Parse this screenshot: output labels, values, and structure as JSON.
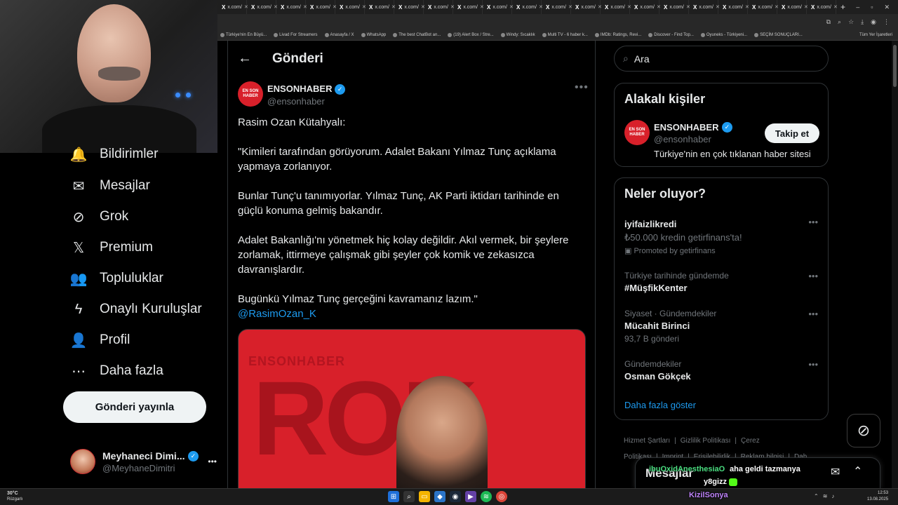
{
  "browser": {
    "tab_label": "x.com/",
    "tab_count": 21,
    "new_tab": "+",
    "window_controls": [
      "–",
      "▫",
      "✕"
    ],
    "bookmarks": [
      "Türkiye'nin En Büyü...",
      "Livad For Streamers",
      "Anasayfa / X",
      "WhatsApp",
      "The best ChatBot an...",
      "(19) Alert Box / Stre...",
      "Windy: Sıcaklık",
      "Multi TV - 6 haber k...",
      "IMDb: Ratings, Revi...",
      "Discover - Find Top...",
      "Oyuneks - Türkiyeni...",
      "SEÇİM SONUÇLARI..."
    ],
    "bookmarks_all": "Tüm Yer İşaretleri"
  },
  "nav": {
    "items": [
      {
        "label": "Bildirimler",
        "icon": "bell-icon",
        "glyph": "🔔"
      },
      {
        "label": "Mesajlar",
        "icon": "mail-icon",
        "glyph": "✉"
      },
      {
        "label": "Grok",
        "icon": "grok-icon",
        "glyph": "⊘"
      },
      {
        "label": "Premium",
        "icon": "x-logo-icon",
        "glyph": "𝕏"
      },
      {
        "label": "Topluluklar",
        "icon": "communities-icon",
        "glyph": "👥"
      },
      {
        "label": "Onaylı Kuruluşlar",
        "icon": "lightning-icon",
        "glyph": "ϟ"
      },
      {
        "label": "Profil",
        "icon": "person-icon",
        "glyph": "👤"
      },
      {
        "label": "Daha fazla",
        "icon": "more-circle-icon",
        "glyph": "⋯"
      }
    ],
    "post_button": "Gönderi yayınla",
    "profile": {
      "name": "Meyhaneci Dimi...",
      "handle": "@MeyhaneDimitri",
      "more": "•••"
    }
  },
  "main": {
    "back": "←",
    "title": "Gönderi",
    "author": {
      "name": "ENSONHABER",
      "handle": "@ensonhaber",
      "avatar_text": "EN SON HABER"
    },
    "more": "•••",
    "paragraphs": [
      "Rasim Ozan Kütahyalı:",
      "\"Kimileri tarafından görüyorum. Adalet Bakanı Yılmaz Tunç açıklama yapmaya zorlanıyor.",
      "Bunlar Tunç'u tanımıyorlar. Yılmaz Tunç, AK Parti iktidarı tarihinde en güçlü konuma gelmiş bakandır.",
      "Adalet Bakanlığı'nı yönetmek hiç kolay değildir. Akıl vermek, bir şeylere zorlamak, ittirmeye çalışmak gibi şeyler çok komik ve zekasızca davranışlardır."
    ],
    "last_paragraph": "Bugünkü Yılmaz Tunç gerçeğini kavramanız lazım.\"",
    "mention": "@RasimOzan_K",
    "media": {
      "brand": "ENSONHABER",
      "bigtext": "ROK"
    }
  },
  "right": {
    "search_placeholder": "Ara",
    "related": {
      "title": "Alakalı kişiler",
      "name": "ENSONHABER",
      "handle": "@ensonhaber",
      "bio": "Türkiye'nin en çok tıklanan haber sitesi",
      "follow": "Takip et"
    },
    "trends": {
      "title": "Neler oluyor?",
      "items": [
        {
          "meta": "",
          "name": "iyifaizlikredi",
          "sub": "₺50.000 kredin getirfinans'ta!",
          "promo": "Promoted by getirfinans"
        },
        {
          "meta": "Türkiye tarihinde gündemde",
          "name": "#MüşfikKenter",
          "sub": "",
          "promo": ""
        },
        {
          "meta": "Siyaset · Gündemdekiler",
          "name": "Mücahit Birinci",
          "sub": "93,7 B gönderi",
          "promo": ""
        },
        {
          "meta": "Gündemdekiler",
          "name": "Osman Gökçek",
          "sub": "",
          "promo": ""
        }
      ],
      "show_more": "Daha fazla göster"
    },
    "footer": {
      "links": [
        "Hizmet Şartları",
        "|",
        "Gizlilik Politikası",
        "|",
        "Çerez Politikası",
        "|",
        "Imprint",
        "|",
        "Erişilebilirlik",
        "|",
        "Reklam bilgisi",
        "|",
        "Dah"
      ]
    },
    "messages_label": "Mesajlar"
  },
  "chat": {
    "line1_user": "ibuOxidAnesthesiaO",
    "line1_text": "aha geldi tazmanya",
    "line2_text": "y8gizz",
    "line3_user": "KizilSonya"
  },
  "taskbar": {
    "weather_temp": "30°C",
    "weather_desc": "Rüzgarlı",
    "time": "12:53",
    "date": "13.08.2025"
  },
  "colors": {
    "accent": "#1d9bf0",
    "background": "#000000",
    "border": "#2f3336",
    "muted": "#71767b",
    "brand_red": "#d8202a"
  }
}
